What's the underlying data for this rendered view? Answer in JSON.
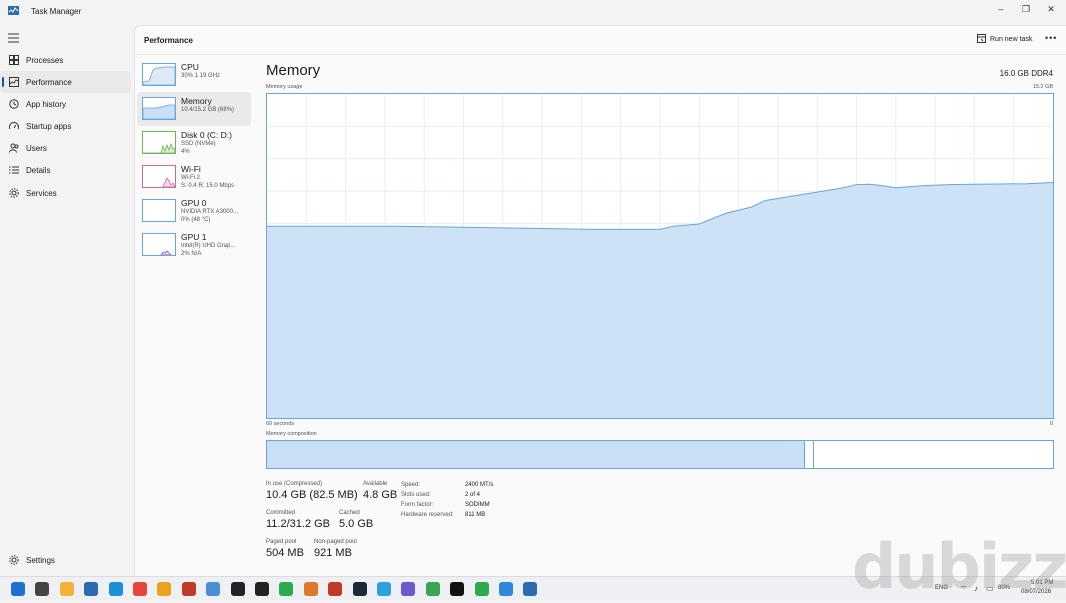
{
  "window": {
    "title": "Task Manager"
  },
  "nav": {
    "items": [
      {
        "label": "Processes",
        "icon": "processes-grid-icon"
      },
      {
        "label": "Performance",
        "icon": "performance-graph-icon",
        "active": true
      },
      {
        "label": "App history",
        "icon": "history-clock-icon"
      },
      {
        "label": "Startup apps",
        "icon": "startup-gauge-icon"
      },
      {
        "label": "Users",
        "icon": "users-icon"
      },
      {
        "label": "Details",
        "icon": "details-list-icon"
      },
      {
        "label": "Services",
        "icon": "services-gear-icon"
      }
    ],
    "settings_label": "Settings"
  },
  "header": {
    "title": "Performance",
    "run_new_task": "Run new task"
  },
  "devices": [
    {
      "name": "CPU",
      "line1": "30%  1.19 GHz",
      "line2": ""
    },
    {
      "name": "Memory",
      "line1": "10.4/15.2 GB (68%)",
      "line2": ""
    },
    {
      "name": "Disk 0 (C: D:)",
      "line1": "SSD (NVMe)",
      "line2": "4%"
    },
    {
      "name": "Wi-Fi",
      "line1": "Wi-Fi 2",
      "line2": "S: 0.4  R: 15.0 Mbps"
    },
    {
      "name": "GPU 0",
      "line1": "NVIDIA RTX A3000...",
      "line2": "0%  (48 °C)"
    },
    {
      "name": "GPU 1",
      "line1": "Intel(R) UHD Grap...",
      "line2": "2%  N/A"
    }
  ],
  "memory": {
    "title": "Memory",
    "total": "16.0 GB DDR4",
    "usage_label": "Memory usage",
    "usage_max": "15.2 GB",
    "time_left": "60 seconds",
    "time_right": "0",
    "composition_label": "Memory composition",
    "composition": {
      "in_use_fraction": 0.685,
      "modified_fraction": 0.012
    },
    "stats": {
      "in_use_label": "In use (Compressed)",
      "in_use_value": "10.4 GB (82.5 MB)",
      "available_label": "Available",
      "available_value": "4.8 GB",
      "committed_label": "Committed",
      "committed_value": "11.2/31.2 GB",
      "cached_label": "Cached",
      "cached_value": "5.0 GB",
      "paged_label": "Paged pool",
      "paged_value": "504 MB",
      "nonpaged_label": "Non-paged pool",
      "nonpaged_value": "921 MB"
    },
    "specs": {
      "speed_label": "Speed:",
      "speed_value": "2400 MT/s",
      "slots_label": "Slots used:",
      "slots_value": "2 of 4",
      "form_label": "Form factor:",
      "form_value": "SODIMM",
      "reserved_label": "Hardware reserved:",
      "reserved_value": "811 MB"
    }
  },
  "chart_data": {
    "type": "area",
    "title": "Memory usage",
    "x": [
      60,
      55,
      50,
      45,
      40,
      35,
      30,
      29,
      27,
      25,
      23,
      22,
      20,
      18,
      16,
      15,
      14,
      13,
      12,
      11,
      10,
      8,
      6,
      4,
      2,
      0
    ],
    "y": [
      9.0,
      9.0,
      9.0,
      8.95,
      8.9,
      8.85,
      8.85,
      9.0,
      9.1,
      9.6,
      9.9,
      10.2,
      10.4,
      10.6,
      10.8,
      10.95,
      10.97,
      10.9,
      10.8,
      10.85,
      10.9,
      10.95,
      10.97,
      10.98,
      10.99,
      11.05
    ],
    "xlabel": "",
    "ylabel": "",
    "xlim": [
      60,
      0
    ],
    "ylim": [
      0,
      15.2
    ],
    "grid": true,
    "fill_color": "#c9dff5",
    "line_color": "#6aa4d9"
  },
  "taskbar": {
    "icons": [
      "windows-start-icon",
      "task-view-icon",
      "file-explorer-icon",
      "store-icon",
      "edge-icon",
      "chrome-icon",
      "chrome-alt-icon",
      "app-red-icon",
      "photos-icon",
      "capcut-icon",
      "app-dark-icon",
      "app-green-icon",
      "microphone-icon",
      "office-icon",
      "steam-icon",
      "telegram-icon",
      "snipping-icon",
      "app-green2-icon",
      "app-terminal-icon",
      "app-green3-icon",
      "app-edit-icon",
      "task-manager-icon"
    ],
    "lang": "ENG",
    "battery": "80%",
    "time": "5:01 PM",
    "date": "08/07/2026"
  },
  "watermark": "dubizzle",
  "colors": {
    "accent": "#005fb8",
    "graph_fill": "#c9dff5",
    "graph_line": "#6aa4d9"
  }
}
